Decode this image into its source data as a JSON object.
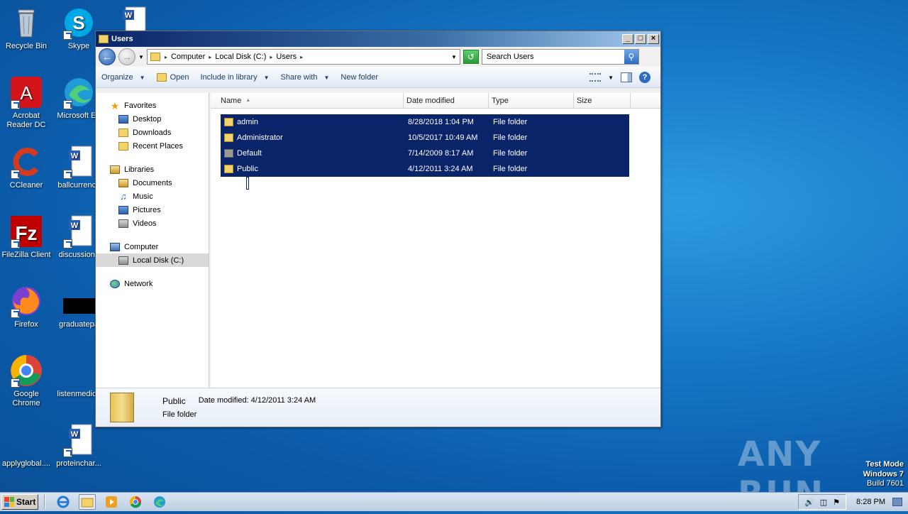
{
  "desktop": {
    "icons": [
      {
        "label": "Recycle Bin",
        "icon": "recycle-bin-icon"
      },
      {
        "label": "Skype",
        "icon": "skype-icon"
      },
      {
        "label": "Acrobat Reader DC",
        "icon": "acrobat-icon"
      },
      {
        "label": "Microsoft Ed",
        "icon": "edge-icon"
      },
      {
        "label": "CCleaner",
        "icon": "ccleaner-icon"
      },
      {
        "label": "ballcurrency",
        "icon": "word-doc-icon"
      },
      {
        "label": "FileZilla Client",
        "icon": "filezilla-icon"
      },
      {
        "label": "discussionc",
        "icon": "word-doc-icon"
      },
      {
        "label": "Firefox",
        "icon": "firefox-icon"
      },
      {
        "label": "graduatepa",
        "icon": "black-file-icon"
      },
      {
        "label": "Google Chrome",
        "icon": "chrome-icon"
      },
      {
        "label": "listenmedica",
        "icon": "blank-file-icon"
      },
      {
        "label": "applyglobal....",
        "icon": "blank-file-icon"
      },
      {
        "label": "proteinchar...",
        "icon": "word-doc-icon"
      }
    ],
    "watermark": "ANY RUN",
    "test_mode": {
      "line1": "Test Mode",
      "line2": "Windows 7",
      "line3": "Build 7601"
    }
  },
  "window": {
    "title": "Users",
    "address": {
      "parts": [
        "Computer",
        "Local Disk (C:)",
        "Users"
      ]
    },
    "search_placeholder": "Search Users",
    "toolbar": {
      "organize": "Organize",
      "open": "Open",
      "include_in_library": "Include in library",
      "share_with": "Share with",
      "new_folder": "New folder"
    },
    "nav": {
      "favorites": "Favorites",
      "desktop": "Desktop",
      "downloads": "Downloads",
      "recent_places": "Recent Places",
      "libraries": "Libraries",
      "documents": "Documents",
      "music": "Music",
      "pictures": "Pictures",
      "videos": "Videos",
      "computer": "Computer",
      "local_disk": "Local Disk (C:)",
      "network": "Network"
    },
    "columns": {
      "name": "Name",
      "date": "Date modified",
      "type": "Type",
      "size": "Size"
    },
    "files": [
      {
        "name": "admin",
        "date": "8/28/2018 1:04 PM",
        "type": "File folder"
      },
      {
        "name": "Administrator",
        "date": "10/5/2017 10:49 AM",
        "type": "File folder"
      },
      {
        "name": "Default",
        "date": "7/14/2009 8:17 AM",
        "type": "File folder"
      },
      {
        "name": "Public",
        "date": "4/12/2011 3:24 AM",
        "type": "File folder"
      }
    ],
    "details": {
      "name": "Public",
      "modified_label": "Date modified: 4/12/2011 3:24 AM",
      "type": "File folder"
    }
  },
  "taskbar": {
    "start": "Start",
    "clock": "8:28 PM"
  }
}
